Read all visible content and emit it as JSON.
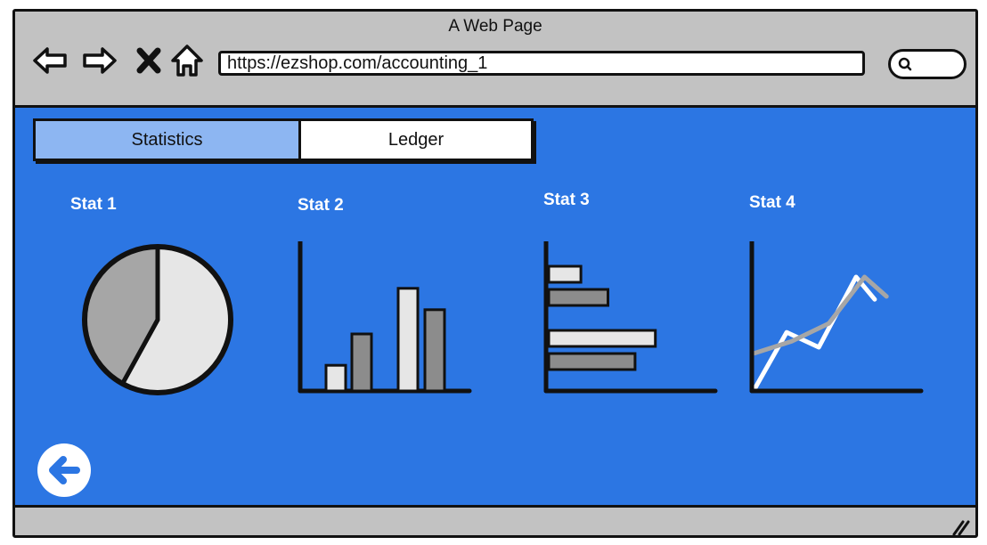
{
  "window": {
    "title": "A Web Page"
  },
  "toolbar": {
    "back_icon": "arrow-left-outline-icon",
    "forward_icon": "arrow-right-outline-icon",
    "stop_icon": "x-icon",
    "home_icon": "home-outline-icon",
    "url": "https://ezshop.com/accounting_1",
    "search_icon": "magnifier-icon"
  },
  "tabs": [
    {
      "label": "Statistics",
      "active": true
    },
    {
      "label": "Ledger",
      "active": false
    }
  ],
  "stats": [
    {
      "label": "Stat 1"
    },
    {
      "label": "Stat 2"
    },
    {
      "label": "Stat 3"
    },
    {
      "label": "Stat 4"
    }
  ],
  "colors": {
    "content_bg": "#2c76e3",
    "chrome_bg": "#c2c2c2",
    "active_tab": "#8db6f2",
    "light_gray": "#e6e6e6",
    "dark_gray": "#8c8c8c",
    "mid_gray": "#a6a6a6"
  },
  "chart_data": [
    {
      "type": "pie",
      "title": "Stat 1",
      "values": [
        58,
        42
      ],
      "colors": [
        "#e6e6e6",
        "#a6a6a6"
      ]
    },
    {
      "type": "bar",
      "title": "Stat 2",
      "values": [
        18,
        40,
        72,
        57
      ],
      "colors": [
        "#e6e6e6",
        "#8c8c8c",
        "#e6e6e6",
        "#8c8c8c"
      ],
      "ylim": [
        0,
        100
      ]
    },
    {
      "type": "bar",
      "orientation": "horizontal",
      "title": "Stat 3",
      "values": [
        19,
        35,
        63,
        51
      ],
      "colors": [
        "#e6e6e6",
        "#8c8c8c",
        "#e6e6e6",
        "#8c8c8c"
      ],
      "xlim": [
        0,
        100
      ]
    },
    {
      "type": "line",
      "title": "Stat 4",
      "series": [
        {
          "values": [
            0,
            38,
            38,
            28,
            75,
            60
          ],
          "x": [
            0,
            1.9,
            1.9,
            3.8,
            6.0,
            7.1
          ],
          "color": "#ffffff"
        },
        {
          "values": [
            24,
            32,
            44,
            75,
            62
          ],
          "x": [
            0,
            2.2,
            4.4,
            6.5,
            7.8
          ],
          "color": "#a6a6a6"
        }
      ],
      "ylim": [
        0,
        100
      ],
      "xlim": [
        0,
        10
      ]
    }
  ],
  "back_button_icon": "circle-arrow-left-icon"
}
